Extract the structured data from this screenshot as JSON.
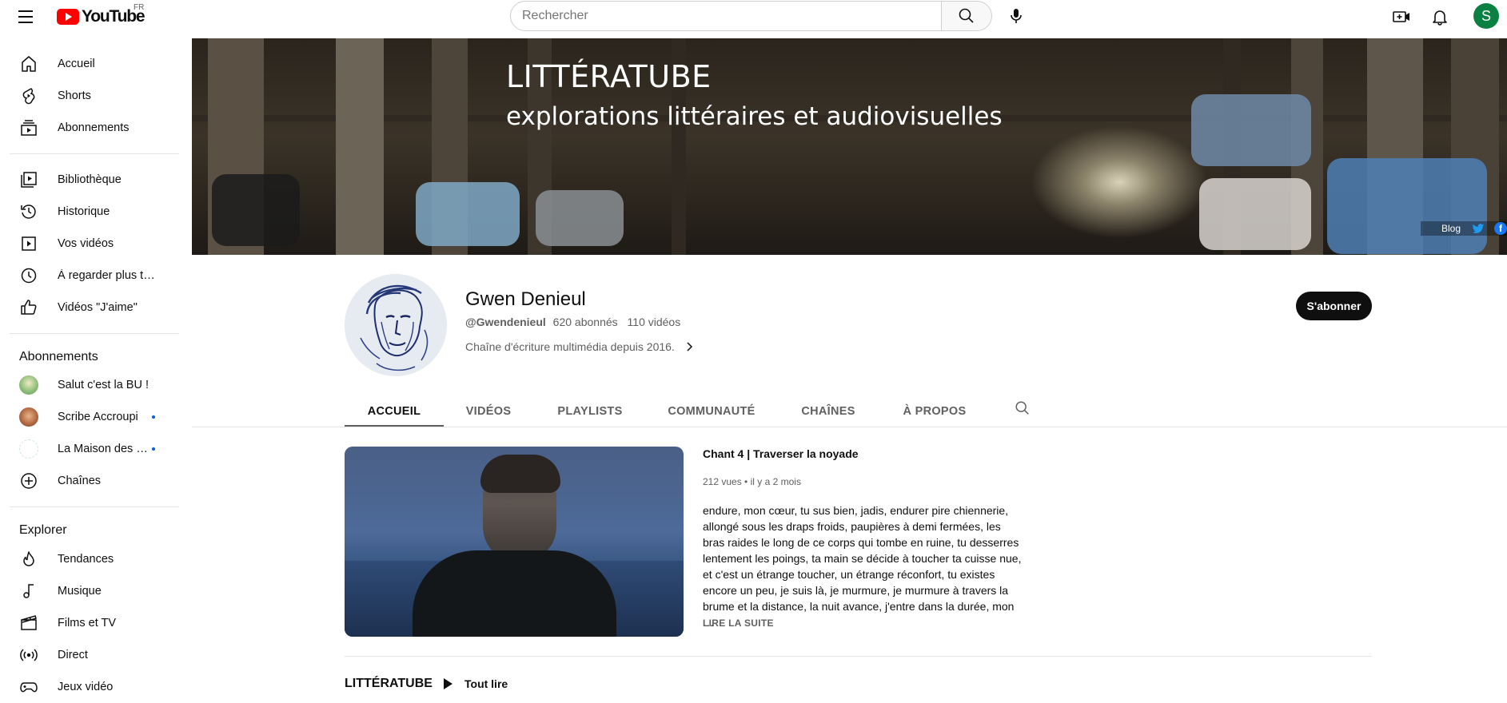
{
  "topbar": {
    "logo_text": "YouTube",
    "country_code": "FR",
    "search_placeholder": "Rechercher",
    "avatar_letter": "S",
    "avatar_color": "#0b8043"
  },
  "sidebar": {
    "main": [
      {
        "label": "Accueil",
        "icon": "home-icon"
      },
      {
        "label": "Shorts",
        "icon": "shorts-icon"
      },
      {
        "label": "Abonnements",
        "icon": "subscriptions-icon"
      }
    ],
    "library": [
      {
        "label": "Bibliothèque",
        "icon": "library-icon"
      },
      {
        "label": "Historique",
        "icon": "history-icon"
      },
      {
        "label": "Vos vidéos",
        "icon": "your-videos-icon"
      },
      {
        "label": "À regarder plus tard",
        "icon": "watch-later-icon"
      },
      {
        "label": "Vidéos \"J'aime\"",
        "icon": "liked-videos-icon"
      }
    ],
    "subscriptions_heading": "Abonnements",
    "subscriptions": [
      {
        "label": "Salut c'est la BU !",
        "new": false
      },
      {
        "label": "Scribe Accroupi",
        "new": true
      },
      {
        "label": "La Maison des Métiers du Livre",
        "new": true
      },
      {
        "label": "Chaînes",
        "icon": "add-channel-icon"
      }
    ],
    "explore_heading": "Explorer",
    "explore": [
      {
        "label": "Tendances",
        "icon": "trending-icon"
      },
      {
        "label": "Musique",
        "icon": "music-icon"
      },
      {
        "label": "Films et TV",
        "icon": "movies-icon"
      },
      {
        "label": "Direct",
        "icon": "live-icon"
      },
      {
        "label": "Jeux vidéo",
        "icon": "gaming-icon"
      }
    ]
  },
  "banner": {
    "title": "LITTÉRATUBE",
    "subtitle": "explorations littéraires et audiovisuelles",
    "link_blog": "Blog"
  },
  "channel": {
    "name": "Gwen Denieul",
    "handle": "@Gwendenieul",
    "subscribers": "620 abonnés",
    "videos": "110 vidéos",
    "description": "Chaîne d'écriture multimédia depuis 2016.",
    "subscribe_label": "S'abonner"
  },
  "tabs": [
    "ACCUEIL",
    "VIDÉOS",
    "PLAYLISTS",
    "COMMUNAUTÉ",
    "CHAÎNES",
    "À PROPOS"
  ],
  "featured": {
    "title": "Chant 4 | Traverser la noyade",
    "views": "212 vues",
    "age": "il y a 2 mois",
    "description": "endure, mon cœur, tu sus bien, jadis, endurer pire chiennerie, allongé sous les draps froids, paupières à demi fermées, les bras raides le long de ce corps qui tombe en ruine, tu desserres lentement les poings, ta main se décide à toucher ta cuisse nue, et c'est un étrange toucher, un étrange réconfort, tu existes encore un peu, je suis là, je murmure, je murmure à travers la brume et la distance, la nuit avance, j'entre dans la durée, mon …",
    "read_more": "LIRE LA SUITE"
  },
  "shelf": {
    "title": "LITTÉRATUBE",
    "play_all": "Tout lire"
  }
}
